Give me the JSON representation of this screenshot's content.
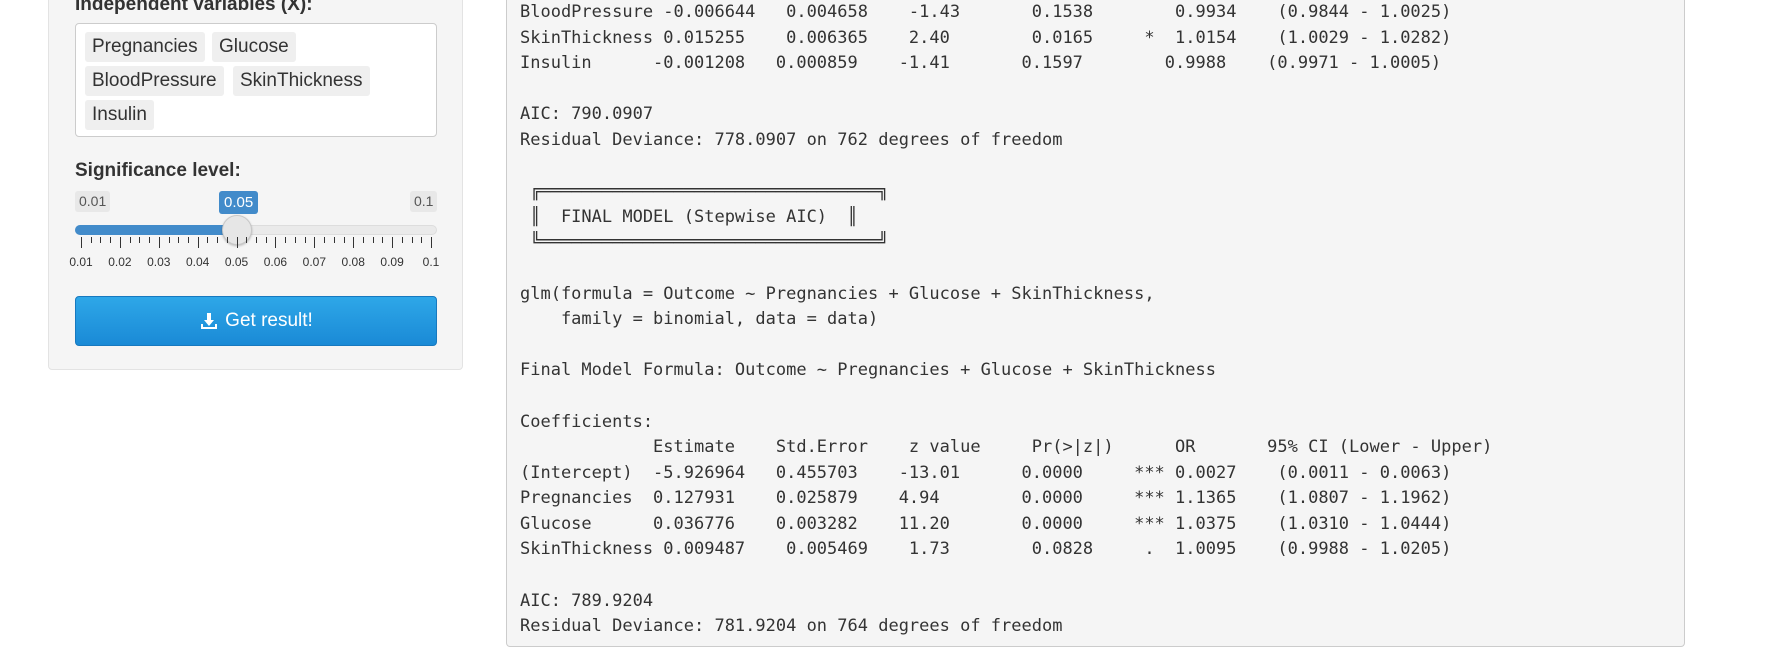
{
  "sidebar": {
    "vars_label": "Independent variables (X):",
    "selected_vars": [
      "Pregnancies",
      "Glucose",
      "BloodPressure",
      "SkinThickness",
      "Insulin"
    ],
    "sig_label": "Significance level:",
    "slider": {
      "min_label": "0.01",
      "max_label": "0.1",
      "current_label": "0.05",
      "min": 0.01,
      "max": 0.1,
      "value": 0.05,
      "tick_labels": [
        "0.01",
        "0.02",
        "0.03",
        "0.04",
        "0.05",
        "0.06",
        "0.07",
        "0.08",
        "0.09",
        "0.1"
      ]
    },
    "button_label": "Get result!",
    "button_icon": "download-icon",
    "accent_color": "#428bca"
  },
  "output": {
    "lines": [
      "BloodPressure -0.006644   0.004658    -1.43       0.1538        0.9934    (0.9844 - 1.0025)",
      "SkinThickness 0.015255    0.006365    2.40        0.0165     *  1.0154    (1.0029 - 1.0282)",
      "Insulin      -0.001208   0.000859    -1.41       0.1597        0.9988    (0.9971 - 1.0005)",
      "",
      "AIC: 790.0907",
      "Residual Deviance: 778.0907 on 762 degrees of freedom",
      "",
      " ╔═════════════════════════════════╗",
      " ║  FINAL MODEL (Stepwise AIC)  ║",
      " ╚═════════════════════════════════╝",
      "",
      "glm(formula = Outcome ~ Pregnancies + Glucose + SkinThickness,",
      "    family = binomial, data = data)",
      "",
      "Final Model Formula: Outcome ~ Pregnancies + Glucose + SkinThickness",
      "",
      "Coefficients:",
      "             Estimate    Std.Error    z value     Pr(>|z|)      OR       95% CI (Lower - Upper)",
      "(Intercept)  -5.926964   0.455703    -13.01      0.0000     *** 0.0027    (0.0011 - 0.0063)",
      "Pregnancies  0.127931    0.025879    4.94        0.0000     *** 1.1365    (1.0807 - 1.1962)",
      "Glucose      0.036776    0.003282    11.20       0.0000     *** 1.0375    (1.0310 - 1.0444)",
      "SkinThickness 0.009487    0.005469    1.73        0.0828     .  1.0095    (0.9988 - 1.0205)",
      "",
      "AIC: 789.9204",
      "Residual Deviance: 781.9204 on 764 degrees of freedom"
    ]
  }
}
